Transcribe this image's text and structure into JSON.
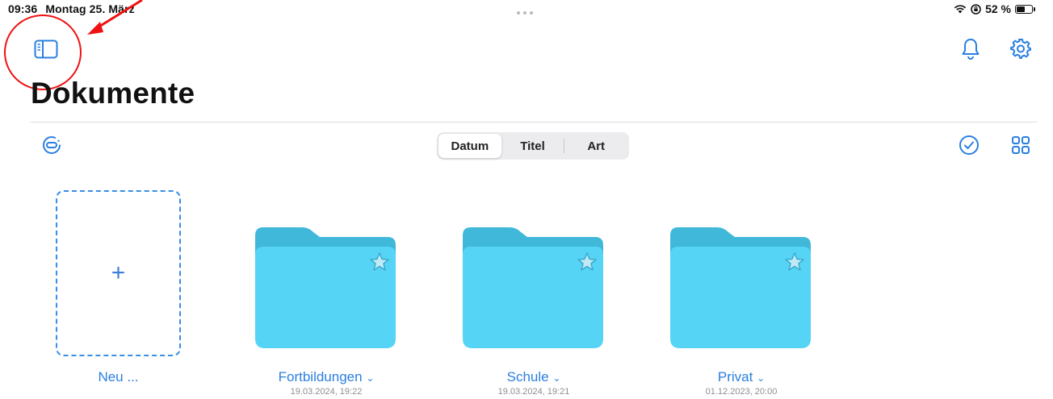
{
  "status_bar": {
    "time": "09:36",
    "date": "Montag 25. März",
    "battery": "52 %",
    "battery_level": 0.52
  },
  "page": {
    "title": "Dokumente"
  },
  "sort_tabs": [
    {
      "label": "Datum",
      "active": true
    },
    {
      "label": "Titel",
      "active": false
    },
    {
      "label": "Art",
      "active": false
    }
  ],
  "new_tile": {
    "label": "Neu ..."
  },
  "folders": [
    {
      "name": "Fortbildungen",
      "date": "19.03.2024, 19:22"
    },
    {
      "name": "Schule",
      "date": "19.03.2024, 19:21"
    },
    {
      "name": "Privat",
      "date": "01.12.2023, 20:00"
    }
  ],
  "icons": {
    "sidebar": "sidebar-icon",
    "notifications": "bell-icon",
    "settings": "gear-icon",
    "filter": "filter-icon",
    "select": "checkmark-circle-icon",
    "grid": "grid-icon",
    "favorite": "star-icon"
  },
  "colors": {
    "accent": "#2a7fe0",
    "folder_front": "#55d4f5",
    "folder_back": "#40b8d9",
    "annotation": "#e11111"
  }
}
